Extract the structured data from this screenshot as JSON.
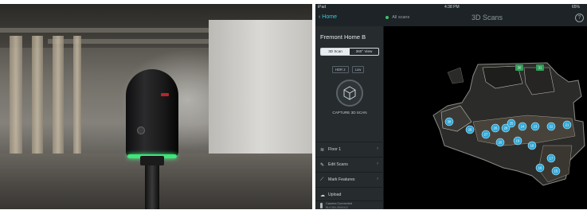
{
  "status_bar": {
    "carrier": "iPad",
    "time": "4:38 PM",
    "battery": "65%"
  },
  "nav": {
    "back_label": "Home",
    "all_scans_label": "All scans",
    "title": "3D Scans",
    "help_icon": "question-circle-icon"
  },
  "sidebar": {
    "project_title": "Fremont Home B",
    "view_modes": [
      {
        "label": "3D Scan",
        "selected": true
      },
      {
        "label": "360° View",
        "selected": false
      }
    ],
    "capture_options": [
      "HDR 2",
      "Low"
    ],
    "capture_label": "CAPTURE 3D SCAN",
    "menu": [
      {
        "icon": "layers-icon",
        "label": "Floor 1"
      },
      {
        "icon": "pencil-icon",
        "label": "Edit Scans"
      },
      {
        "icon": "ruler-icon",
        "label": "Mark Features"
      },
      {
        "icon": "cloud-upload-icon",
        "label": "Upload"
      }
    ],
    "camera_status": {
      "line1": "Camera Connected",
      "line2": "BLK360-3500412"
    }
  },
  "map": {
    "accent_color": "#2fa8d8",
    "scan_points": [
      "30",
      "31",
      "38",
      "29",
      "27",
      "26",
      "28",
      "25",
      "24",
      "23",
      "22",
      "21",
      "20",
      "19",
      "18",
      "17",
      "16",
      "15"
    ]
  }
}
